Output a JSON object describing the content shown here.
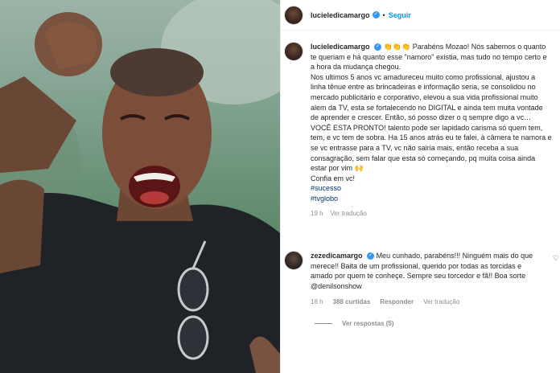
{
  "header": {
    "username": "lucieledicamargo",
    "separator": "•",
    "follow_label": "Seguir"
  },
  "caption": {
    "username": "lucieledicamargo",
    "emojis": "👏👏👏",
    "p1": "Parabéns Mozao! Nós sabemos o quanto te queriam e há quanto esse \"namoro\" existia, mas tudo no tempo certo e a hora da mudança chegou.",
    "p2": "Nos ultimos 5 anos vc amadureceu muito como profissional, ajustou a linha tênue entre as brincadeiras e informação seria, se consolidou no mercado publicitário e corporativo, elevou a sua vida profissional muito alem da TV, esta se fortalecendo no DIGITAL e ainda tem muita vontade de aprender e crescer. Então, só posso dizer o q sempre digo a vc… VOCÊ ESTA PRONTO! talento pode ser lapidado carisma só quem tem, tem, e vc tem de sobra. Ha 15 anos atrás eu te falei, à câmera te namora e se vc entrasse para a TV, vc não sairia mais, então receba a sua consagração, sem falar que esta só começando, pq muita coisa ainda estar por vim 🙌",
    "p3": "Confia em vc!",
    "tag1": "#sucesso",
    "tag2": "#tvglobo",
    "time": "19 h",
    "translate": "Ver tradução"
  },
  "comment": {
    "username": "zezedicamargo",
    "text": "Meu cunhado, parabéns!!! Ninguém mais do que merece!! Baita de um profissional, querido por todas as torcidas e amado por quem te conheçe. Sempre seu torcedor e fã!! Boa sorte @denilsonshow",
    "time": "18 h",
    "likes": "388 curtidas",
    "reply": "Responder",
    "translate": "Ver tradução",
    "view_replies": "Ver respostas (5)"
  },
  "icons": {
    "verified": "verified-badge-icon",
    "like": "heart-outline-icon"
  },
  "colors": {
    "link_blue": "#0095f6",
    "verified_blue": "#3897f0",
    "hashtag": "#00376b",
    "muted": "#8e8e8e"
  }
}
